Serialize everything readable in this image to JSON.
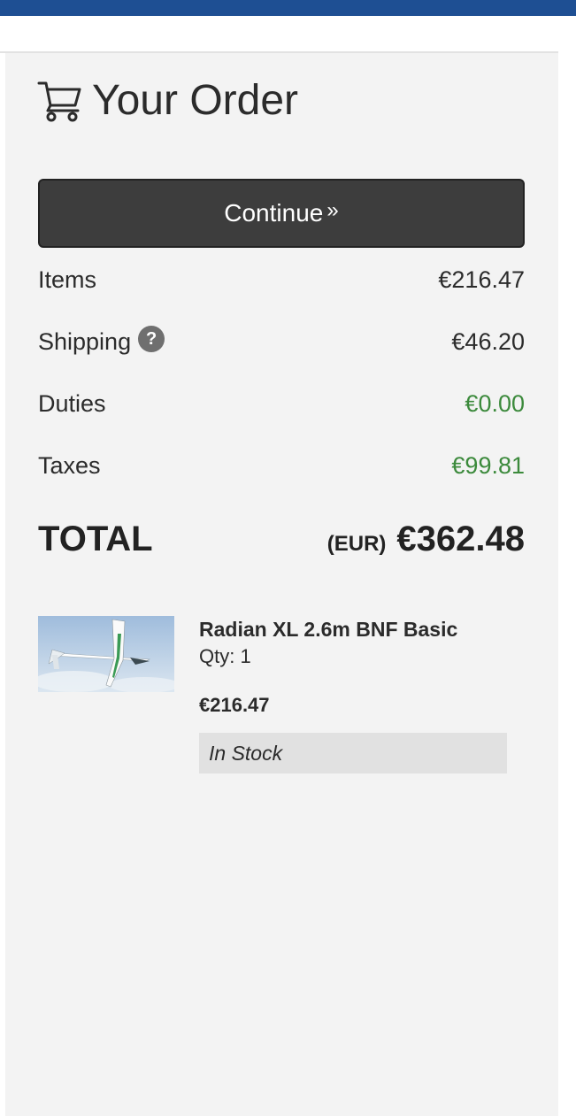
{
  "order": {
    "title": "Your Order",
    "continue_label": "Continue",
    "continue_chevron": "»"
  },
  "summary": {
    "items_label": "Items",
    "items_value": "€216.47",
    "shipping_label": "Shipping",
    "shipping_help": "?",
    "shipping_value": "€46.20",
    "duties_label": "Duties",
    "duties_value": "€0.00",
    "taxes_label": "Taxes",
    "taxes_value": "€99.81",
    "total_label": "TOTAL",
    "total_currency": "(EUR)",
    "total_value": "€362.48"
  },
  "product": {
    "name": "Radian XL 2.6m BNF Basic",
    "qty": "Qty: 1",
    "price": "€216.47",
    "stock": "In Stock"
  },
  "colors": {
    "top_bar": "#1e4f93",
    "panel_bg": "#f3f3f3",
    "button_bg": "#3d3d3d",
    "green_value": "#3c8a3c",
    "stock_badge_bg": "#e1e1e1"
  },
  "icons": {
    "cart": "shopping-cart-icon",
    "help": "question-circle-icon"
  }
}
